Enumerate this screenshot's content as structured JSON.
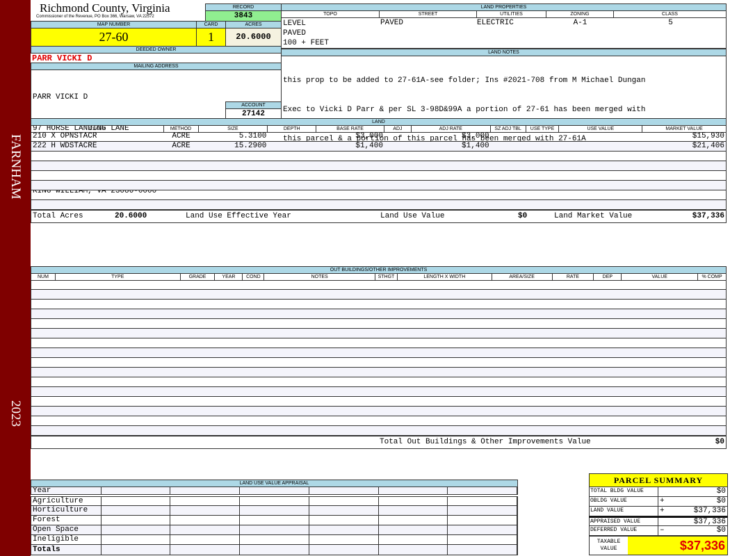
{
  "sidebar": {
    "district": "FARNHAM",
    "year": "2023",
    "color": "#7f0000"
  },
  "header": {
    "county": "Richmond County, Virginia",
    "subtitle": "Commissioner of the Revenue, PO Box 366, Warsaw, VA 22572"
  },
  "record": {
    "label": "RECORD",
    "value": "3843"
  },
  "map": {
    "map_label": "MAP NUMBER",
    "map_value": "27-60",
    "card_label": "CARD",
    "card_value": "1",
    "acres_label": "ACRES",
    "acres_value": "20.6000"
  },
  "owner": {
    "label": "DEEDED OWNER",
    "value": "PARR VICKI D"
  },
  "mailing": {
    "label": "MAILING ADDRESS",
    "lines": [
      "PARR VICKI D",
      "97 HORSE LANDING LANE",
      "",
      "KING WILLIAM, VA 23086-0000"
    ]
  },
  "account": {
    "label": "ACCOUNT",
    "value": "27142"
  },
  "land_properties": {
    "label": "LAND PROPERTIES",
    "headers": [
      "TOPO",
      "STREET",
      "UTILITIES",
      "ZONING",
      "CLASS"
    ],
    "topo": [
      "LEVEL",
      "PAVED",
      "100 + FEET"
    ],
    "street": "PAVED",
    "utilities": "ELECTRIC",
    "zoning": "A-1",
    "class": "5"
  },
  "land_notes": {
    "label": "LAND NOTES",
    "lines": [
      "this prop to be added to 27-61A-see folder; Ins #2021-708 from M Michael Dungan",
      "Exec to Vicki D Parr & per SL 3-98D&99A a portion of 27-61 has been merged with",
      "this parcel & a portion of this parcel has been merged with 27-61A"
    ]
  },
  "land": {
    "label": "LAND",
    "headers": [
      "CLASS",
      "METHOD",
      "SIZE",
      "DEPTH",
      "BASE RATE",
      "ADJ",
      "ADJ RATE",
      "SZ ADJ TBL",
      "USE TYPE",
      "USE VALUE",
      "MARKET VALUE"
    ],
    "rows": [
      [
        "210 X OPNSTACR",
        "ACRE",
        "5.3100",
        "",
        "$3,000",
        "",
        "$3,000",
        "",
        "",
        "",
        "$15,930"
      ],
      [
        "222 H WDSTACRE",
        "ACRE",
        "15.2900",
        "",
        "$1,400",
        "",
        "$1,400",
        "",
        "",
        "",
        "$21,406"
      ]
    ],
    "totals": {
      "acres_label": "Total Acres",
      "acres": "20.6000",
      "effective_year_label": "Land Use Effective Year",
      "use_value_label": "Land Use Value",
      "use_value": "$0",
      "market_label": "Land Market Value",
      "market": "$37,336"
    }
  },
  "outbuildings": {
    "label": "OUT BUILDINGS/OTHER IMPROVEMENTS",
    "headers": [
      "NUM",
      "TYPE",
      "GRADE",
      "YEAR",
      "COND",
      "NOTES",
      "STHGT",
      "LENGTH X WIDTH",
      "AREA/SIZE",
      "RATE",
      "DEP",
      "VALUE",
      "% COMP"
    ],
    "total_label": "Total Out Buildings & Other Improvements Value",
    "total": "$0"
  },
  "land_use": {
    "label": "LAND USE VALUE APPRAISAL",
    "year_label": "Year",
    "rows": [
      "Agriculture",
      "Horticulture",
      "Forest",
      "Open Space",
      "Ineligible"
    ],
    "totals_label": "Totals"
  },
  "summary": {
    "title": "PARCEL SUMMARY",
    "rows": [
      {
        "label": "TOTAL BLDG VALUE",
        "op": "",
        "value": "$0"
      },
      {
        "label": "OBLDG VALUE",
        "op": "+",
        "value": "$0"
      },
      {
        "label": "LAND VALUE",
        "op": "+",
        "value": "$37,336"
      },
      {
        "label": "APPRAISED VALUE",
        "op": "",
        "value": "$37,336"
      },
      {
        "label": "DEFERRED VALUE",
        "op": "–",
        "value": "$0"
      }
    ],
    "taxable_label": "TAXABLE VALUE",
    "taxable": "$37,336"
  }
}
